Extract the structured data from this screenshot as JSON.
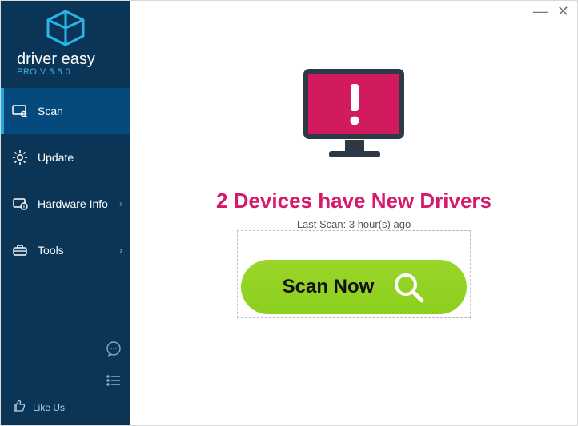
{
  "window": {
    "minimize_glyph": "—",
    "close_glyph": "✕"
  },
  "brand": {
    "name": "driver easy",
    "version_label": "PRO V 5.5.0"
  },
  "sidebar": {
    "items": [
      {
        "label": "Scan",
        "icon": "scan-icon",
        "active": true,
        "has_submenu": false
      },
      {
        "label": "Update",
        "icon": "gear-icon",
        "active": false,
        "has_submenu": false
      },
      {
        "label": "Hardware Info",
        "icon": "hardware-icon",
        "active": false,
        "has_submenu": true
      },
      {
        "label": "Tools",
        "icon": "toolbox-icon",
        "active": false,
        "has_submenu": true
      }
    ],
    "like_label": "Like Us"
  },
  "main": {
    "headline": "2 Devices have New Drivers",
    "subline": "Last Scan: 3 hour(s) ago",
    "scan_button_label": "Scan Now"
  },
  "colors": {
    "sidebar_bg": "#0b3557",
    "sidebar_active": "#064a7d",
    "accent_cyan": "#22a7e0",
    "headline_pink": "#d61a6b",
    "alert_pink": "#d21a5e",
    "scan_green": "#8ccf1d"
  }
}
